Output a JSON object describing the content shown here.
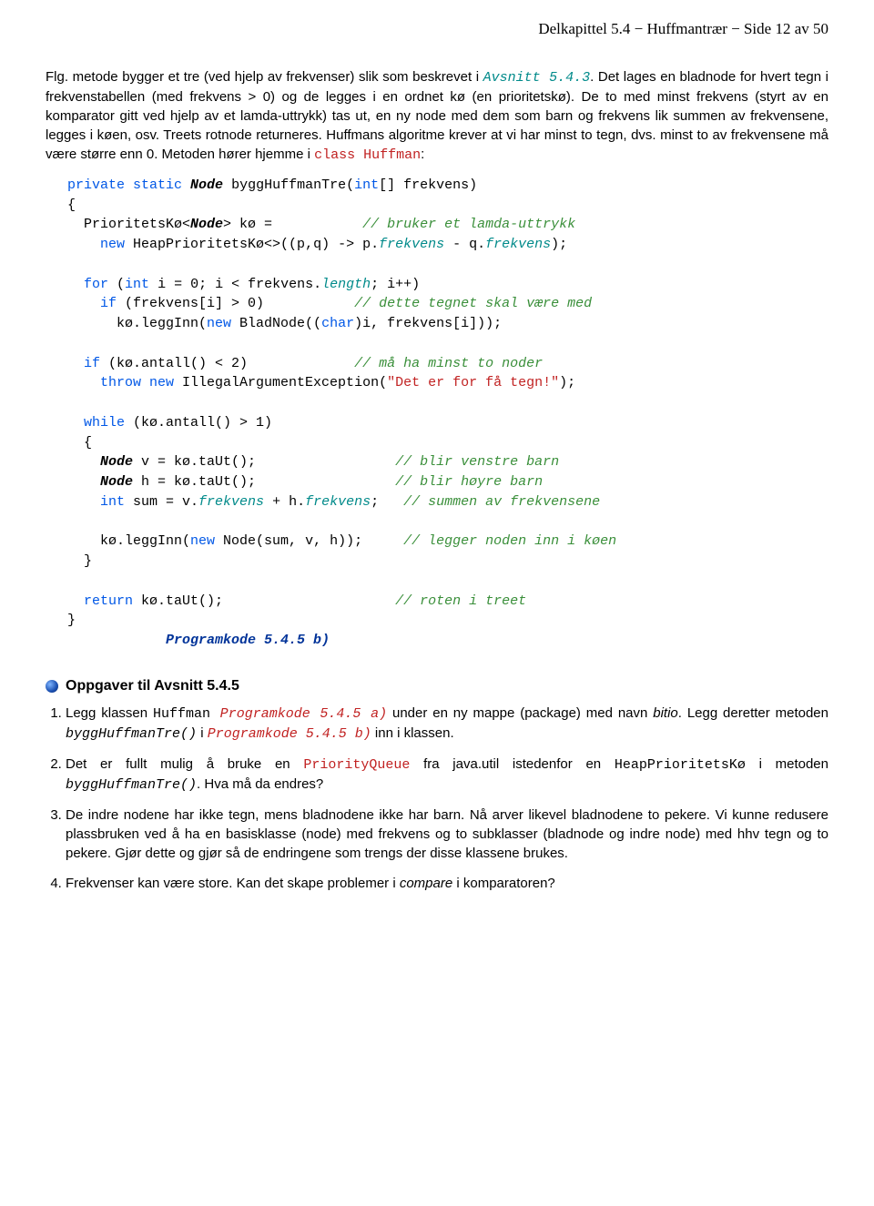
{
  "header": "Delkapittel 5.4 − Huffmantrær − Side 12 av 50",
  "p1_a": "Flg. metode bygger et tre (ved hjelp av frekvenser) slik som beskrevet i ",
  "p1_link": "Avsnitt 5.4.3",
  "p1_b": ". Det lages en bladnode for hvert tegn i frekvenstabellen (med frekvens > 0) og de legges i en ordnet kø (en prioritetskø). De to med minst frekvens (styrt av en komparator gitt ved hjelp av et lamda-uttrykk) tas ut, en ny node med dem som barn og frekvens lik summen av frekvensene, legges i køen, osv. Treets rotnode returneres. Huffmans algoritme krever at vi har minst to tegn, dvs. minst to av frekvensene må være større enn 0. Metoden hører hjemme i ",
  "p1_class": "class Huffman",
  "p1_c": ":",
  "code_caption": "Programkode 5.4.5 b)",
  "section_title": "Oppgaver til Avsnitt 5.4.5",
  "task1_a": "Legg klassen ",
  "task1_b": "Huffman",
  "task1_c": " Programkode 5.4.5 a)",
  "task1_d": " under en ny mappe (package) med navn ",
  "task1_e": "bitio",
  "task1_f": ". Legg deretter metoden ",
  "task1_g": "byggHuffmanTre()",
  "task1_h": " i ",
  "task1_i": "Programkode 5.4.5 b)",
  "task1_j": " inn i klassen.",
  "task2_a": "Det er fullt mulig å bruke en ",
  "task2_b": "PriorityQueue",
  "task2_c": " fra java.util istedenfor en ",
  "task2_d": "HeapPrioritetsKø",
  "task2_e": " i metoden ",
  "task2_f": "byggHuffmanTre()",
  "task2_g": ". Hva må da endres?",
  "task3": "De indre nodene har ikke tegn, mens bladnodene ikke har barn. Nå arver likevel bladnodene to pekere. Vi kunne redusere plassbruken ved å ha en basisklasse (node) med frekvens og to subklasser (bladnode og indre node) med hhv tegn og to pekere. Gjør dette og gjør så de endringene som trengs der disse klassene brukes.",
  "task4_a": "Frekvenser kan være store. Kan det skape problemer i ",
  "task4_b": "compare",
  "task4_c": " i komparatoren?"
}
